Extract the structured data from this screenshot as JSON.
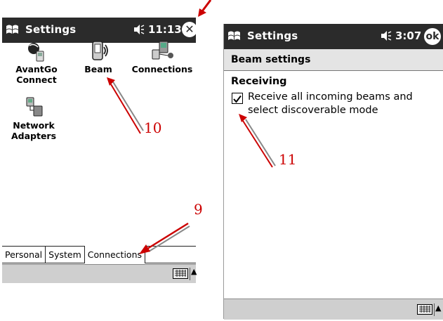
{
  "left_screen": {
    "title": "Settings",
    "time": "11:13",
    "close_label": "✕",
    "icons": [
      {
        "label_line1": "AvantGo",
        "label_line2": "Connect"
      },
      {
        "label_line1": "Beam",
        "label_line2": ""
      },
      {
        "label_line1": "Connections",
        "label_line2": ""
      },
      {
        "label_line1": "Network",
        "label_line2": "Adapters"
      }
    ],
    "tabs": [
      "Personal",
      "System",
      "Connections"
    ],
    "active_tab": "Connections"
  },
  "right_screen": {
    "title": "Settings",
    "time": "3:07",
    "ok_label": "ok",
    "subtitle": "Beam settings",
    "section": "Receiving",
    "checkbox_label": "Receive all incoming beams and select discoverable mode",
    "checkbox_checked": true
  },
  "annotations": [
    "9",
    "10",
    "11"
  ],
  "colors": {
    "title_bg": "#2b2b2b",
    "arrow": "#cc0000",
    "bar": "#cfcfcf"
  },
  "icon_names": [
    "windows-flag-icon",
    "speaker-icon",
    "close-icon",
    "ok-icon",
    "keyboard-icon"
  ]
}
